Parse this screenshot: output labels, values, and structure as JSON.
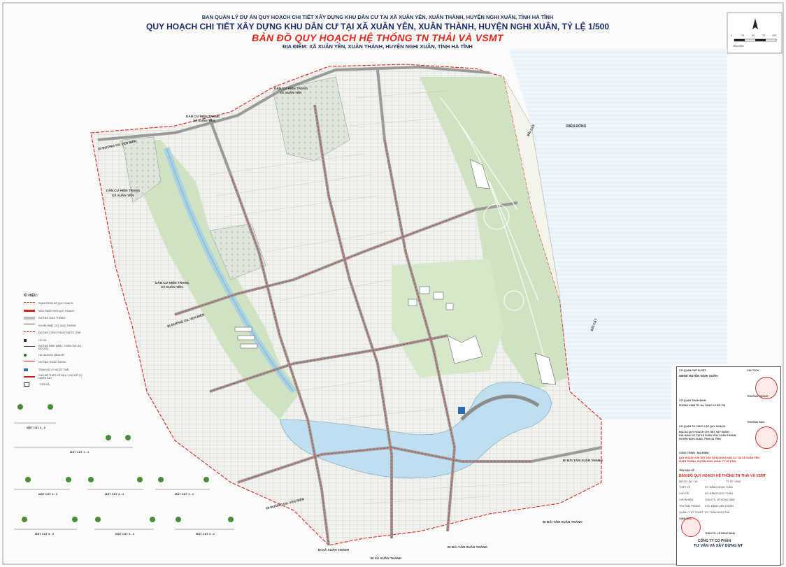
{
  "header": {
    "line1": "BAN QUẢN LÝ DỰ ÁN QUY HOẠCH CHI TIẾT XÂY DỰNG KHU DÂN CƯ TẠI XÃ XUÂN YÊN, XUÂN THÀNH, HUYỆN NGHI XUÂN, TỈNH HÀ TĨNH",
    "line2": "QUY HOẠCH CHI TIẾT XÂY DỰNG KHU DÂN CƯ TẠI XÃ XUÂN YÊN, XUÂN THÀNH, HUYỆN NGHI XUÂN, TỶ LỆ 1/500",
    "line3": "BẢN ĐỒ QUY HOẠCH HỆ THỐNG TN THẢI VÀ VSMT",
    "line4": "ĐỊA ĐIỂM: XÃ XUÂN YÊN, XUÂN THÀNH, HUYỆN NGHI XUÂN, TỈNH HÀ TĨNH"
  },
  "scale_bar": {
    "ticks": [
      "0",
      "25",
      "50",
      "75",
      "100"
    ],
    "note": "1Đv=25m"
  },
  "map_labels": {
    "dan_cu_1": "DÂN CƯ HIỆN TRẠNG",
    "dan_cu_1b": "XÃ XUÂN YÊN",
    "dan_cu_2": "DÂN CƯ HIỆN TRẠNG",
    "dan_cu_2b": "XÃ XUÂN YÊN",
    "dan_cu_3": "DÂN CƯ HIỆN TRẠNG",
    "dan_cu_3b": "XÃ XUÂN YÊN",
    "dan_cu_4": "DÂN CƯ HIỆN TRẠNG",
    "dan_cu_4b": "XÃ XUÂN YÊN",
    "bien_dong": "BIỂN ĐÔNG",
    "bai_cat": "BÃI CÁT",
    "bai_cat_2": "BÃI CÁT",
    "di_duong_1": "ĐI ĐƯỜNG GIL VEN BIỂN",
    "di_duong_2": "ĐI ĐƯỜNG GIL VEN BIỂN",
    "di_duong_3": "ĐI ĐƯỜNG GIL VEN BIỂN",
    "di_bai_tam_1": "ĐI BÃI TẮM XUÂN THÀNH",
    "di_bai_tam_2": "ĐI BÃI TẮM XUÂN THÀNH",
    "di_bai_tam_3": "ĐI BÃI TẮM XUÂN THÀNH",
    "di_xa_1": "ĐI XÃ XUÂN THÀNH",
    "di_xa_2": "ĐI XÃ XUÂN THÀNH"
  },
  "legend": {
    "title": "KÍ HIỆU:",
    "items": [
      {
        "label": "RANH GIỚI LẬP QUY HOẠCH",
        "color": "#d7261b"
      },
      {
        "label": "MỐC RANH GIỚI QUY HOẠCH",
        "color": "#d7261b"
      },
      {
        "label": "ĐƯỜNG GIAO THÔNG",
        "color": "#888888"
      },
      {
        "label": "KÍ HIỆU MẶT CẮT GIAO THÔNG",
        "color": "#555555"
      },
      {
        "label": "ĐƯỜNG CỐNG THOÁT NƯỚC THẢI",
        "color": "#c8352b"
      },
      {
        "label": "HỒ GA",
        "color": "#333333"
      },
      {
        "label": "ĐƯỜNG KÍNH (MM) - CHIỀU DÀI (M) - ĐỘ DỐC",
        "color": "#444444"
      },
      {
        "label": "HỐ GA ĐƠN TĂNG ĐP",
        "color": "#2d6b2d"
      },
      {
        "label": "HƯỚNG THOÁT NƯỚC",
        "color": "#d7261b"
      },
      {
        "label": "TRẠM XỬ LÝ NƯỚC THẢI",
        "color": "#2b6cb0"
      },
      {
        "label": "CAO ĐỘ THIẾT KẾ ĐÁY / CAO ĐỘ TỰ NHIÊN ĐÁY",
        "color": "#d7261b"
      },
      {
        "label": "CỬA XẢ",
        "color": "#333333"
      }
    ]
  },
  "sections": {
    "s1": "MẶT CẮT 6 - 6",
    "s2": "MẶT CẮT 1 - 1",
    "s3": "MẶT CẮT 3 - 3",
    "s4": "MẶT CẮT 4 - 4",
    "s5": "MẶT CẮT 2 - 2",
    "s6": "MẶT CẮT 5 - 5",
    "s7": "MẶT CẮT 3 - 3",
    "s8": "MẶT CẮT 2 - 2"
  },
  "title_block": {
    "co_quan_phe_duyet": "CƠ QUAN PHÊ DUYỆT:",
    "chu_tich": "CHỦ TỊCH",
    "ubnd": "UBND HUYỆN NGHI XUÂN",
    "co_quan_tham_dinh": "CƠ QUAN THẨM ĐỊNH:",
    "truong_phong": "TRƯỞNG PHÒNG",
    "phong": "PHÒNG KINH TẾ, HẠ TẦNG VÀ ĐÔ THỊ",
    "co_quan_to_chuc": "CƠ QUAN TỔ CHỨC LẬP QUY HOẠCH:",
    "truong_ban": "TRƯỞNG BAN",
    "bqlda_1": "BQLDA QUY HOẠCH CHI TIẾT XÂY DỰNG",
    "bqlda_2": "KHU DÂN CƯ TẠI XÃ XUÂN YÊN, XUÂN THÀNH,",
    "bqlda_3": "HUYỆN NGHI XUÂN, TỈNH HÀ TĨNH",
    "cong_trinh": "CÔNG TRÌNH - ĐỊA ĐIỂM:",
    "ct_1": "QUY HOẠCH CHI TIẾT XÂY DỰNG KHU DÂN CƯ TẠI XÃ XUÂN YÊN,",
    "ct_2": "XUÂN THÀNH, HUYỆN NGHI XUÂN, TỶ LỆ 1/500",
    "ten_ban_ve": "TÊN BẢN VẼ:",
    "ban_ve": "BẢN ĐỒ QUY HOẠCH HỆ THỐNG TN THẢI VÀ VSMT",
    "rows": [
      {
        "k": "THIẾT KẾ",
        "v": "KS. ĐẶNG NGỌC TUẤN"
      },
      {
        "k": "CHỦ TRÌ",
        "v": "KS. ĐẶNG NGỌC TUẤN"
      },
      {
        "k": "CHỦ NHIỆM",
        "v": "THS.KTS. LÊ HỒNG NAM"
      },
      {
        "k": "TRƯỞNG PHÒNG",
        "v": "KTS. ĐẶNG VĂN THÀNH"
      },
      {
        "k": "QUẢN LÝ KỸ THUẬT",
        "v": "KS. TRẦN NGỌC HẢI"
      }
    ],
    "giam_doc": "GIÁM ĐỐC",
    "director": "THS.KTS. LÊ HỒNG NAM",
    "company_1": "CÔNG TY CỔ PHẦN",
    "company_2": "TƯ VẤN VÀ XÂY DỰNG NT",
    "ti_le": "TỶ LỆ: 1/500",
    "ma_so": "MÃ SỐ: QH - 06"
  }
}
